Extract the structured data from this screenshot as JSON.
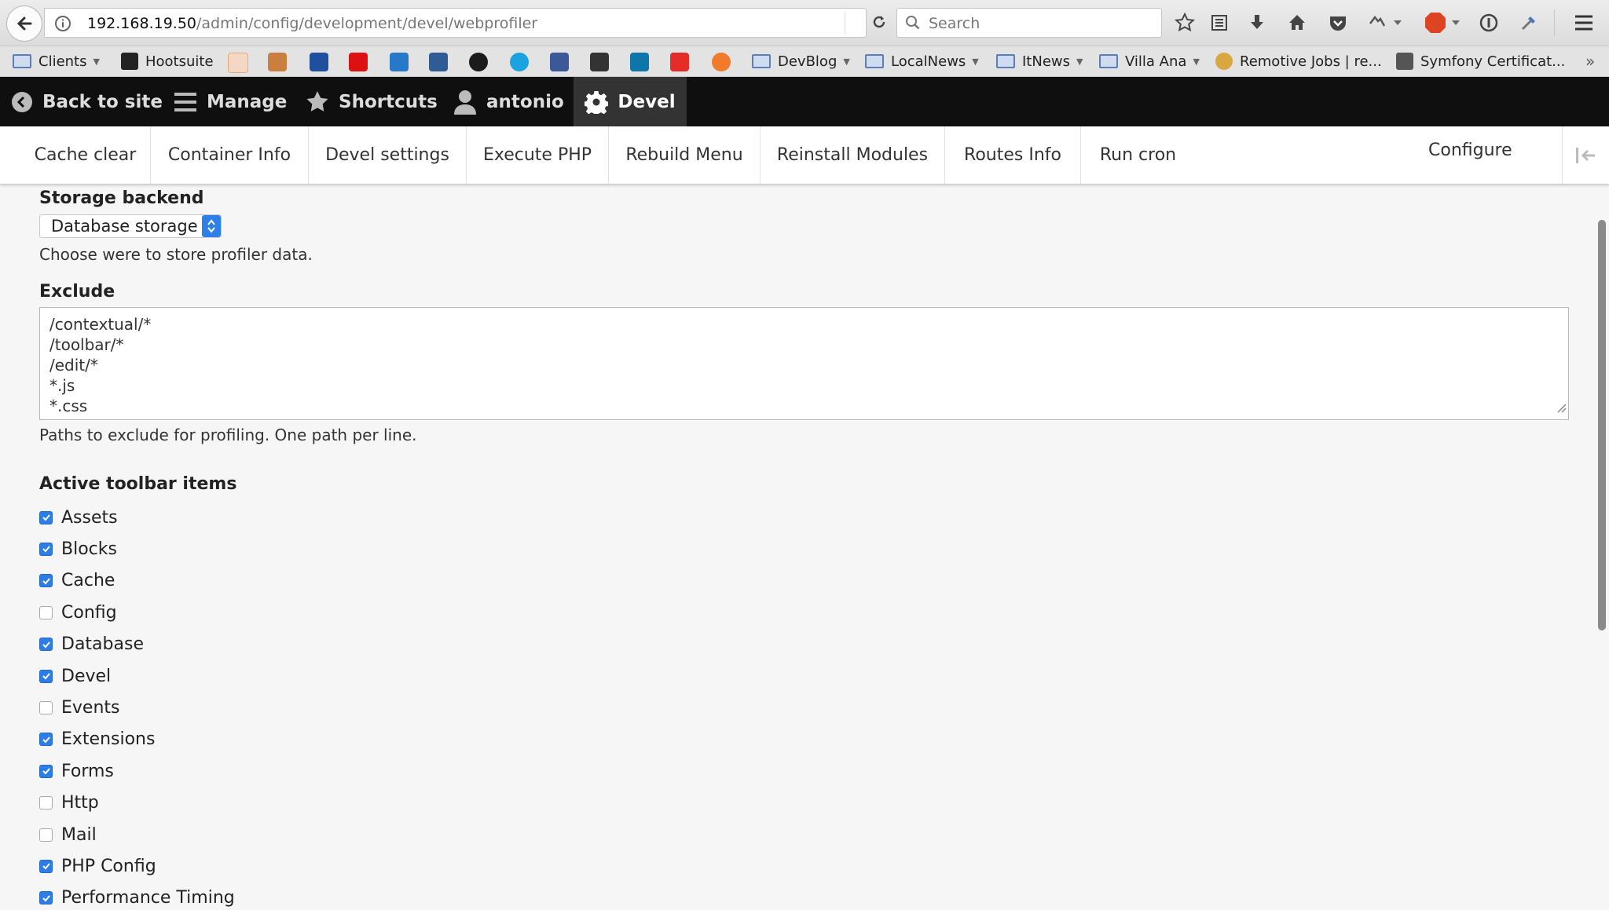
{
  "browser": {
    "url_host": "192.168.19.50",
    "url_path": "/admin/config/development/devel/webprofiler",
    "search_placeholder": "Search",
    "toolbar_icons": [
      "bookmark-star-icon",
      "reading-list-icon",
      "download-icon",
      "home-icon",
      "pocket-icon",
      "extension-icon",
      "adblock-icon",
      "password-icon",
      "eyedropper-icon",
      "menu-icon"
    ],
    "adblock_label": "ABP"
  },
  "bookmarks": [
    {
      "label": "Clients",
      "type": "folder-menu"
    },
    {
      "label": "Hootsuite",
      "type": "site"
    },
    {
      "label": "DevBlog",
      "type": "folder-menu"
    },
    {
      "label": "LocalNews",
      "type": "folder-menu"
    },
    {
      "label": "ItNews",
      "type": "folder-menu"
    },
    {
      "label": "Villa Ana",
      "type": "folder-menu"
    },
    {
      "label": "Remotive Jobs | re...",
      "type": "site"
    },
    {
      "label": "Symfony Certificat...",
      "type": "site"
    }
  ],
  "admin_toolbar": {
    "back": "Back to site",
    "manage": "Manage",
    "shortcuts": "Shortcuts",
    "user": "antonio",
    "devel": "Devel"
  },
  "tray": {
    "items": [
      "Cache clear",
      "Container Info",
      "Devel settings",
      "Execute PHP",
      "Rebuild Menu",
      "Reinstall Modules",
      "Routes Info",
      "Run cron"
    ],
    "configure": "Configure"
  },
  "form": {
    "storage": {
      "label": "Storage backend",
      "value": "Database storage",
      "description": "Choose were to store profiler data."
    },
    "exclude": {
      "label": "Exclude",
      "lines": [
        "/contextual/*",
        "/toolbar/*",
        "/edit/*",
        "*.js",
        "*.css"
      ],
      "description": "Paths to exclude for profiling. One path per line."
    },
    "toolbar_items": {
      "label": "Active toolbar items",
      "items": [
        {
          "label": "Assets",
          "checked": true
        },
        {
          "label": "Blocks",
          "checked": true
        },
        {
          "label": "Cache",
          "checked": true
        },
        {
          "label": "Config",
          "checked": false
        },
        {
          "label": "Database",
          "checked": true
        },
        {
          "label": "Devel",
          "checked": true
        },
        {
          "label": "Events",
          "checked": false
        },
        {
          "label": "Extensions",
          "checked": true
        },
        {
          "label": "Forms",
          "checked": true
        },
        {
          "label": "Http",
          "checked": false
        },
        {
          "label": "Mail",
          "checked": false
        },
        {
          "label": "PHP Config",
          "checked": true
        },
        {
          "label": "Performance Timing",
          "checked": true
        }
      ]
    }
  }
}
